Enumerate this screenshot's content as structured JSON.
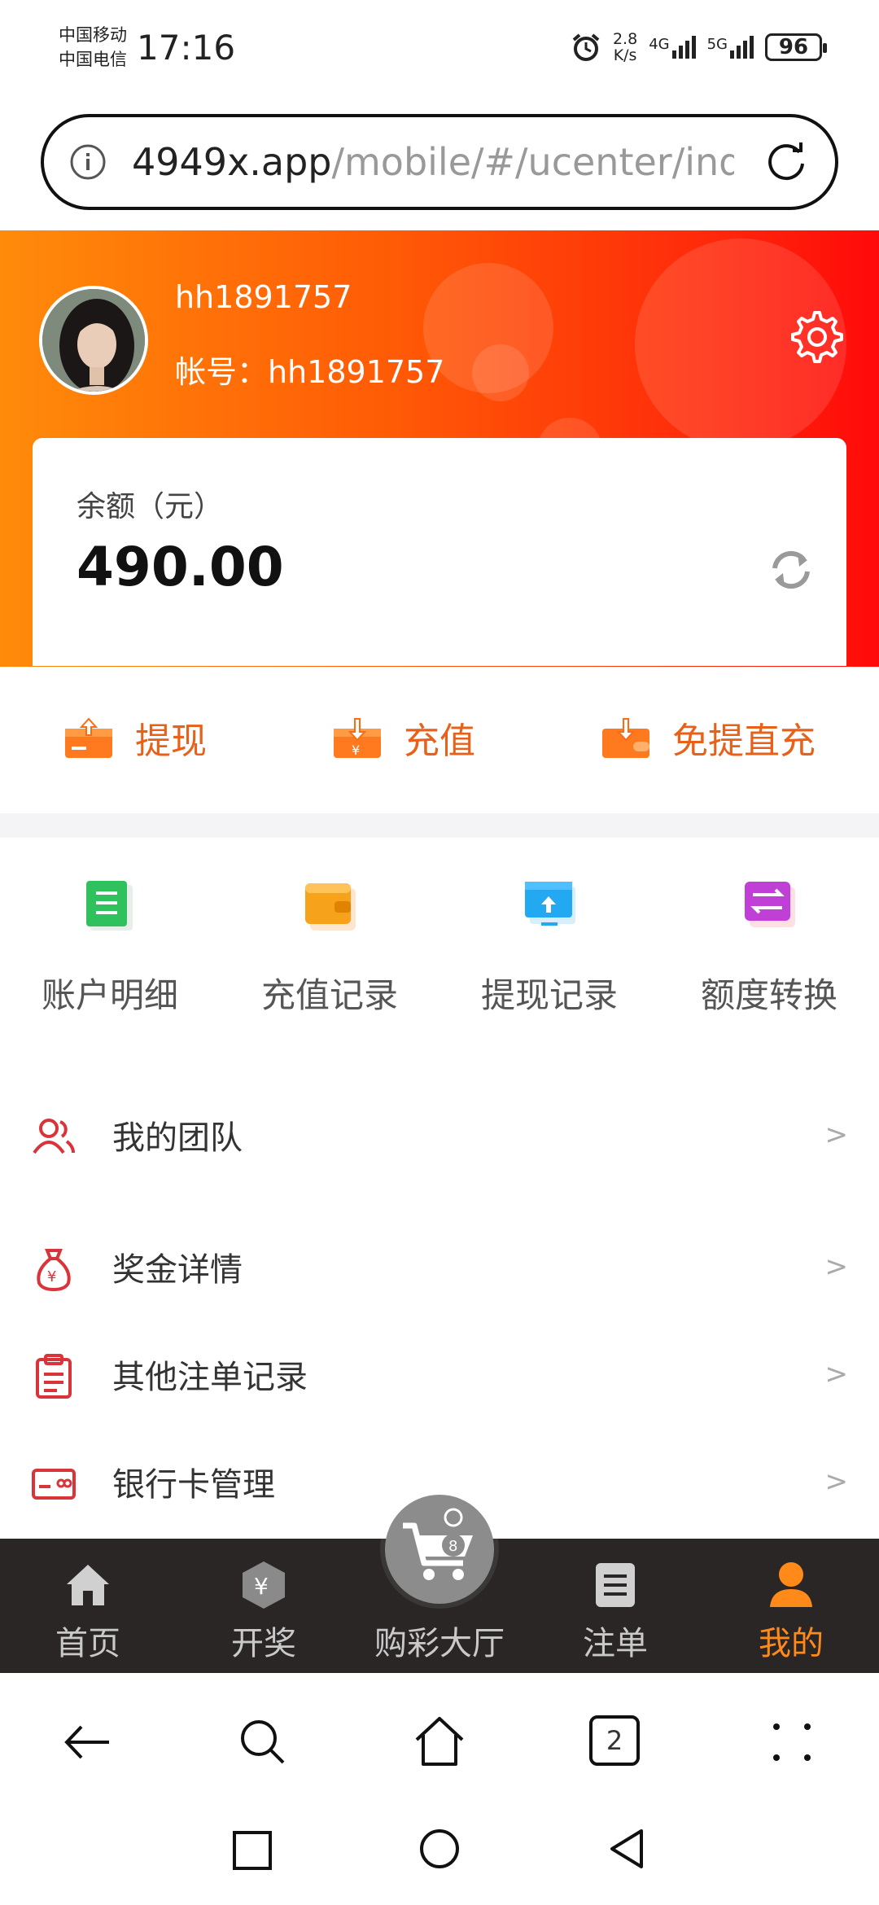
{
  "status_bar": {
    "carrier_1": "中国移动",
    "carrier_2": "中国电信",
    "time": "17:16",
    "net_speed_value": "2.8",
    "net_speed_unit": "K/s",
    "net_4g": "4G",
    "net_5g": "5G",
    "battery": "96"
  },
  "url_bar": {
    "host": "4949x.app",
    "path": "/mobile/#/ucenter/inde"
  },
  "profile": {
    "username": "hh1891757",
    "account_label": "帐号：hh1891757"
  },
  "balance": {
    "label": "余额（元）",
    "value": "490.00"
  },
  "actions": [
    {
      "label": "提现",
      "icon": "withdraw-icon"
    },
    {
      "label": "充值",
      "icon": "deposit-icon"
    },
    {
      "label": "免提直充",
      "icon": "direct-recharge-icon"
    }
  ],
  "grid": [
    {
      "label": "账户明细",
      "icon": "account-detail-icon",
      "color": "#2fc15e"
    },
    {
      "label": "充值记录",
      "icon": "wallet-icon",
      "color": "#f7a21b"
    },
    {
      "label": "提现记录",
      "icon": "upload-screen-icon",
      "color": "#23a9f2"
    },
    {
      "label": "额度转换",
      "icon": "transfer-icon",
      "color": "#c03fd6"
    }
  ],
  "menu": [
    {
      "label": "我的团队",
      "icon": "team-icon",
      "arrow": ">"
    },
    {
      "label": "奖金详情",
      "icon": "money-bag-icon",
      "arrow": ">"
    },
    {
      "label": "其他注单记录",
      "icon": "clipboard-icon",
      "arrow": ">"
    },
    {
      "label": "银行卡管理",
      "icon": "bank-card-icon",
      "arrow": ">"
    }
  ],
  "tabbar": [
    {
      "label": "首页",
      "icon": "home-icon"
    },
    {
      "label": "开奖",
      "icon": "lottery-draw-icon"
    },
    {
      "label": "购彩大厅",
      "icon": "cart-icon"
    },
    {
      "label": "注单",
      "icon": "order-list-icon"
    },
    {
      "label": "我的",
      "icon": "user-icon"
    }
  ],
  "browser_nav": {
    "tab_count": "2"
  },
  "colors": {
    "header_start": "#ff8b0a",
    "header_end": "#ff0a0a",
    "action_text": "#e8611a",
    "tab_active": "#ff8a1a",
    "tabbar_bg": "#2a2626",
    "menu_icon": "#d9343a"
  }
}
